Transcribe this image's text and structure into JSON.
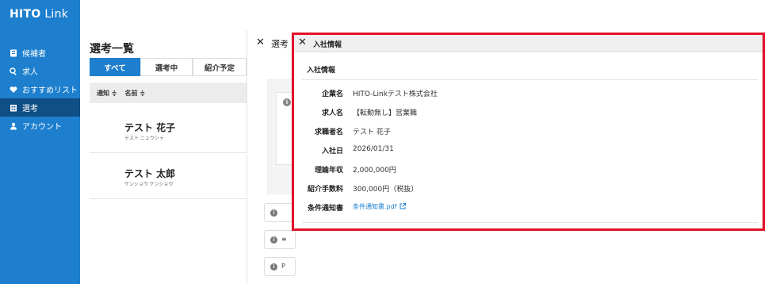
{
  "app": {
    "logo_main": "HITO",
    "logo_sub": " Link"
  },
  "sidebar": {
    "items": [
      {
        "label": "候補者",
        "icon": "id-card-icon"
      },
      {
        "label": "求人",
        "icon": "search-icon"
      },
      {
        "label": "おすすめリスト",
        "icon": "heart-icon"
      },
      {
        "label": "選考",
        "icon": "calendar-icon",
        "active": true
      },
      {
        "label": "アカウント",
        "icon": "user-icon"
      }
    ]
  },
  "list": {
    "title": "選考一覧",
    "tabs": [
      {
        "label": "すべて",
        "active": true
      },
      {
        "label": "選考中",
        "active": false
      },
      {
        "label": "紹介予定",
        "active": false
      }
    ],
    "columns": [
      "通知 ≑",
      "名前 ≑"
    ],
    "rows": [
      {
        "name": "テスト 花子",
        "kana": "テスト ニュウシャ"
      },
      {
        "name": "テスト 太郎",
        "kana": "ケンショウ ケンショウ"
      }
    ]
  },
  "background_panel": {
    "close": "✕",
    "title": "選考",
    "cards": [
      "i",
      "i",
      "i"
    ],
    "card_letters": [
      "",
      "≡",
      "P"
    ]
  },
  "modal": {
    "close": "✕",
    "header_title": "入社情報",
    "section_title": "入社情報",
    "fields": [
      {
        "label": "企業名",
        "value": "HITO-Linkテスト株式会社"
      },
      {
        "label": "求人名",
        "value": "【転勤無し】営業職"
      },
      {
        "label": "求職者名",
        "value": "テスト 花子"
      },
      {
        "label": "入社日",
        "value": "2026/01/31"
      },
      {
        "label": "理論年収",
        "value": "2,000,000円"
      },
      {
        "label": "紹介手数料",
        "value": "300,000円（税抜）"
      },
      {
        "label": "条件通知書",
        "value": "条件通知書.pdf"
      }
    ]
  },
  "colors": {
    "brand": "#1d7fce",
    "sidebar_active": "#0f4f86",
    "highlight": "#e2112a"
  }
}
